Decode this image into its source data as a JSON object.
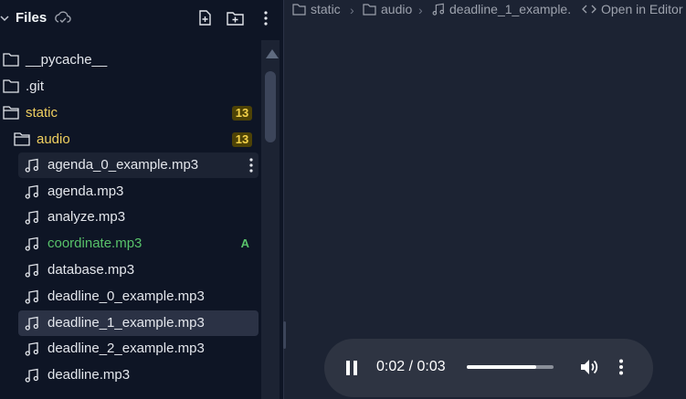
{
  "sidebar": {
    "title": "Files",
    "header_icons": [
      "chevron-down-icon",
      "cloud-sync-icon",
      "new-file-icon",
      "new-folder-icon",
      "more-vertical-icon"
    ],
    "rows": [
      {
        "label": "__pycache__",
        "kind": "folder",
        "name": "pycache"
      },
      {
        "label": ".git",
        "kind": "folder",
        "name": "git"
      },
      {
        "label": "static",
        "kind": "folder-open",
        "name": "static",
        "badge": "13"
      },
      {
        "label": "audio",
        "kind": "folder-open",
        "name": "audio",
        "badge": "13"
      },
      {
        "label": "agenda_0_example.mp3",
        "kind": "audio",
        "name": "agenda-0-example"
      },
      {
        "label": "agenda.mp3",
        "kind": "audio",
        "name": "agenda"
      },
      {
        "label": "analyze.mp3",
        "kind": "audio",
        "name": "analyze"
      },
      {
        "label": "coordinate.mp3",
        "kind": "audio",
        "name": "coordinate",
        "git_status": "A"
      },
      {
        "label": "database.mp3",
        "kind": "audio",
        "name": "database"
      },
      {
        "label": "deadline_0_example.mp3",
        "kind": "audio",
        "name": "deadline-0-example"
      },
      {
        "label": "deadline_1_example.mp3",
        "kind": "audio",
        "name": "deadline-1-example"
      },
      {
        "label": "deadline_2_example.mp3",
        "kind": "audio",
        "name": "deadline-2-example"
      },
      {
        "label": "deadline.mp3",
        "kind": "audio",
        "name": "deadline"
      }
    ]
  },
  "breadcrumb": {
    "items": [
      "static",
      "audio",
      "deadline_1_example."
    ],
    "open_in_editor": "Open in Editor"
  },
  "player": {
    "time": "0:02 / 0:03",
    "progress": 0.8
  },
  "colors": {
    "sidebar_bg": "#0e1525",
    "editor_bg": "#1c2333",
    "badge_text": "#f5d34a",
    "git_added": "#58c26a"
  }
}
